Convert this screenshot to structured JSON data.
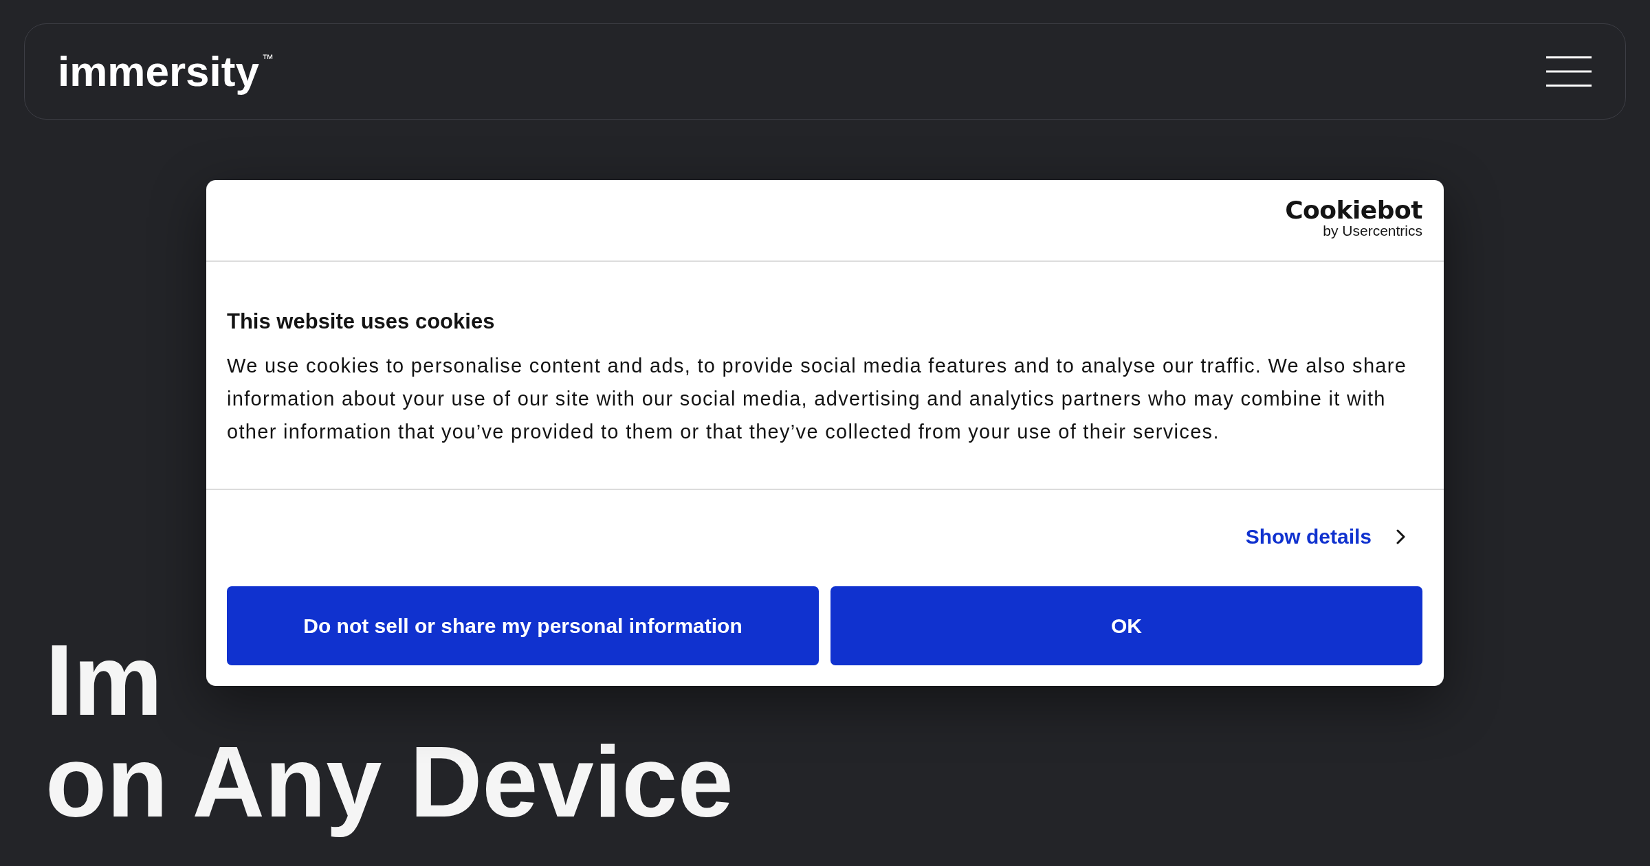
{
  "header": {
    "logo": "immersity$^{™}$"
  },
  "hero": {
    "headline_lines": [
      "Im",
      "on Any Device"
    ]
  },
  "cookie_dialog": {
    "brand": "Cookiebot",
    "brand_byline": "by Usercentrics",
    "title": "This website uses cookies",
    "body": "We use cookies to personalise content and ads, to provide social media features and to analyse our traffic. We also share information about your use of our site with our social media, advertising and analytics partners who may combine it with other information that you’ve provided to them or that they’ve collected from your use of their services.",
    "details_link": "Show details",
    "buttons": [
      "Do not sell or share my personal information",
      "OK"
    ]
  }
}
